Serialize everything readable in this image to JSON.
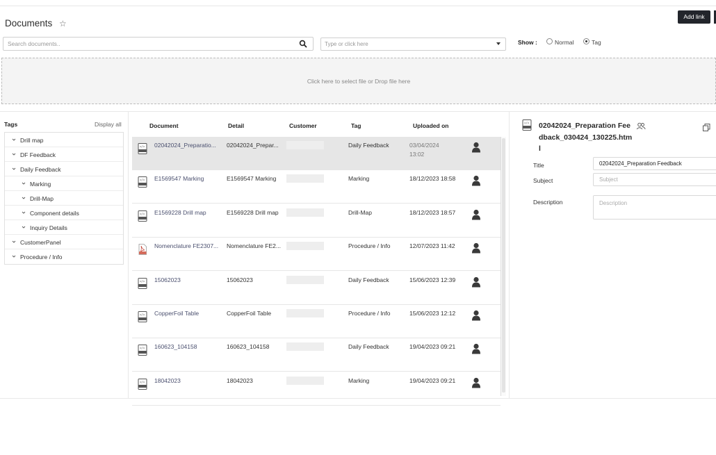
{
  "header": {
    "title": "Documents",
    "favorite_icon": "star-outline-icon",
    "add_link_label": "Add link"
  },
  "search": {
    "placeholder": "Search documents..",
    "icon": "search-icon"
  },
  "tag_filter": {
    "placeholder": "Type or click here"
  },
  "show": {
    "label": "Show :",
    "options": [
      {
        "label": "Normal",
        "selected": false
      },
      {
        "label": "Tag",
        "selected": true
      }
    ]
  },
  "dropzone": {
    "text": "Click here to select file or Drop file here"
  },
  "tags_panel": {
    "title": "Tags",
    "display_all": "Display all",
    "items": [
      {
        "label": "Drill map",
        "level": 0
      },
      {
        "label": "DF Feedback",
        "level": 0
      },
      {
        "label": "Daily Feedback",
        "level": 0
      },
      {
        "label": "Marking",
        "level": 1
      },
      {
        "label": "Drill-Map",
        "level": 1
      },
      {
        "label": "Component details",
        "level": 1
      },
      {
        "label": "Inquiry Details",
        "level": 1
      },
      {
        "label": "CustomerPanel",
        "level": 0
      },
      {
        "label": "Procedure / Info",
        "level": 0
      }
    ]
  },
  "table": {
    "columns": [
      "Document",
      "Detail",
      "Customer",
      "Tag",
      "Uploaded on"
    ],
    "rows": [
      {
        "document": "02042024_Preparatio...",
        "detail": "02042024_Prepar...",
        "tag": "Daily Feedback",
        "uploaded": "03/04/2024",
        "uploaded_time": "13:02",
        "file_type": "html",
        "selected": true
      },
      {
        "document": "E1569547 Marking",
        "detail": "E1569547 Marking",
        "tag": "Marking",
        "uploaded": "18/12/2023 18:58",
        "file_type": "html",
        "selected": false
      },
      {
        "document": "E1569228 Drill map",
        "detail": "E1569228 Drill map",
        "tag": "Drill-Map",
        "uploaded": "18/12/2023 18:57",
        "file_type": "html",
        "selected": false
      },
      {
        "document": "Nomenclature FE2307...",
        "detail": "Nomenclature FE2...",
        "tag": "Procedure / Info",
        "uploaded": "12/07/2023 11:42",
        "file_type": "pdf",
        "selected": false
      },
      {
        "document": "15062023",
        "detail": "15062023",
        "tag": "Daily Feedback",
        "uploaded": "15/06/2023 12:39",
        "file_type": "html",
        "selected": false
      },
      {
        "document": "CopperFoil Table",
        "detail": "CopperFoil Table",
        "tag": "Procedure / Info",
        "uploaded": "15/06/2023 12:12",
        "file_type": "html",
        "selected": false
      },
      {
        "document": "160623_104158",
        "detail": "160623_104158",
        "tag": "Daily Feedback",
        "uploaded": "19/04/2023 09:21",
        "file_type": "html",
        "selected": false
      },
      {
        "document": "18042023",
        "detail": "18042023",
        "tag": "Marking",
        "uploaded": "19/04/2023 09:21",
        "file_type": "html",
        "selected": false
      }
    ]
  },
  "detail_panel": {
    "file_name": "02042024_Preparation Feedback_030424_130225.html",
    "fields": {
      "title_label": "Title",
      "title_value": "02042024_Preparation Feedback",
      "subject_label": "Subject",
      "subject_placeholder": "Subject",
      "description_label": "Description",
      "description_placeholder": "Description"
    }
  },
  "colors": {
    "accent_dark": "#22252b",
    "link_text": "#4a4f6e",
    "selected_row": "#e6e6e6"
  }
}
